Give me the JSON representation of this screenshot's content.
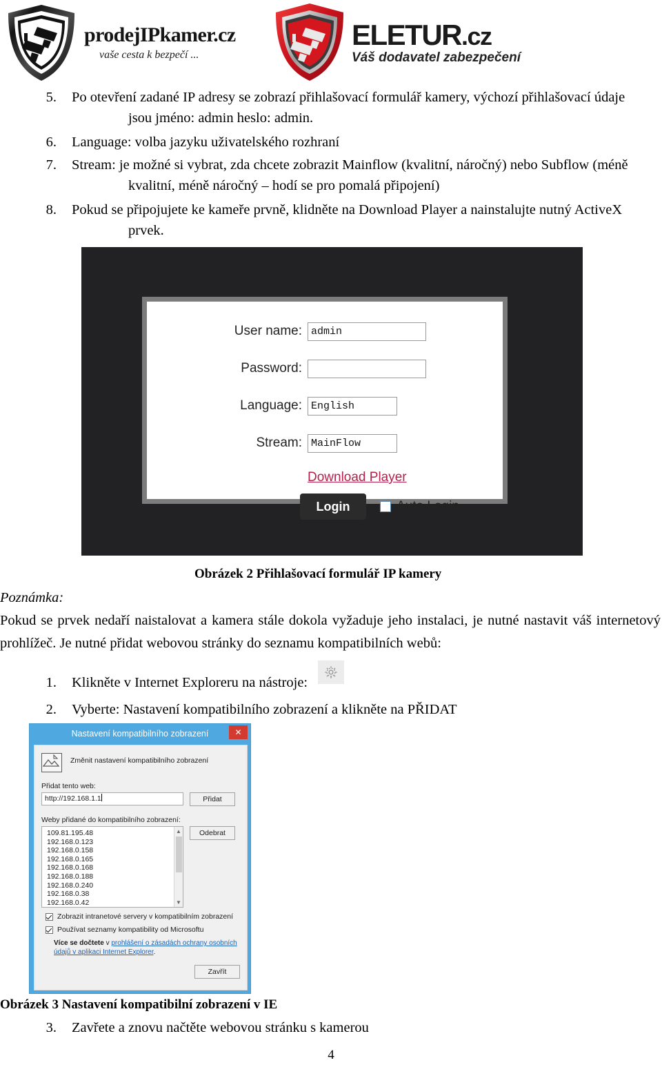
{
  "header": {
    "logo_left": {
      "brand": "prodejIPkamer.cz",
      "tagline": "vaše cesta k bezpečí ...",
      "icon": "shield-camera-icon"
    },
    "logo_right": {
      "brand_main": "ELETUR",
      "brand_tld": ".cz",
      "tagline": "Váš dodavatel zabezpečení",
      "icon": "shield-camera-icon"
    }
  },
  "instructions_top": [
    {
      "num": "5.",
      "line1": "Po otevření zadané IP adresy se zobrazí přihlašovací formulář kamery, výchozí přihlašovací údaje",
      "line2": "jsou jméno: admin heslo: admin."
    },
    {
      "num": "6.",
      "line1": "Language: volba jazyku uživatelského rozhraní",
      "line2": ""
    },
    {
      "num": "7.",
      "line1": "Stream: je možné si vybrat, zda chcete zobrazit Mainflow (kvalitní, náročný) nebo Subflow (méně",
      "line2": "kvalitní, méně náročný – hodí se pro pomalá připojení)"
    },
    {
      "num": "8.",
      "line1": "Pokud se připojujete ke kameře prvně, klidněte na Download Player a nainstalujte nutný ActiveX",
      "line2": "prvek."
    }
  ],
  "login_form": {
    "username_label": "User name:",
    "username_value": "admin",
    "password_label": "Password:",
    "password_value": "",
    "language_label": "Language:",
    "language_value": "English",
    "stream_label": "Stream:",
    "stream_value": "MainFlow",
    "download_link": "Download Player",
    "login_button": "Login",
    "auto_login_label": "Auto Login",
    "auto_login_checked": false
  },
  "figure2_caption": "Obrázek 2 Přihlašovací formulář IP kamery",
  "note": {
    "heading": "Poznámka:",
    "body": "Pokud se prvek nedaří naistalovat a kamera stále dokola vyžaduje jeho instalaci, je nutné nastavit váš internetový prohlížeč. Je nutné přidat webovou stránky do seznamu kompatibilních webů:"
  },
  "instructions_bottom": [
    {
      "num": "1.",
      "text": "Klikněte v Internet Exploreru na nástroje:",
      "icon": "gear-icon"
    },
    {
      "num": "2.",
      "text": "Vyberte: Nastavení kompatibilního zobrazení a klikněte na PŘIDAT",
      "icon": ""
    }
  ],
  "ie_dialog": {
    "title": "Nastavení kompatibilního zobrazení",
    "close_label": "✕",
    "header_text": "Změnit nastavení kompatibilního zobrazení",
    "add_label": "Přidat tento web:",
    "add_value": "http://192.168.1.1",
    "add_button": "Přidat",
    "list_label": "Weby přidané do kompatibilního zobrazení:",
    "list_items": [
      "109.81.195.48",
      "192.168.0.123",
      "192.168.0.158",
      "192.168.0.165",
      "192.168.0.168",
      "192.168.0.188",
      "192.168.0.240",
      "192.168.0.38",
      "192.168.0.42"
    ],
    "remove_button": "Odebrat",
    "checkbox1": "Zobrazit intranetové servery v kompatibilním zobrazení",
    "checkbox1_checked": true,
    "checkbox2": "Používat seznamy kompatibility od Microsoftu",
    "checkbox2_checked": true,
    "note_prefix": "Více se dočtete",
    "note_mid": " v ",
    "note_link": "prohlášení o zásadách ochrany osobních údajů v aplikaci Internet Explorer",
    "note_suffix": ".",
    "close_button": "Zavřít"
  },
  "figure3_caption": "Obrázek 3 Nastavení kompatibilní zobrazení v IE",
  "instruction_last": {
    "num": "3.",
    "text": "Zavřete a znovu načtěte webovou stránku s kamerou"
  },
  "page_number": "4",
  "colors": {
    "link_red": "#b5204a",
    "dialog_blue": "#4fa8e0",
    "close_red": "#d33b31",
    "logo_red": "#d71f2a"
  }
}
